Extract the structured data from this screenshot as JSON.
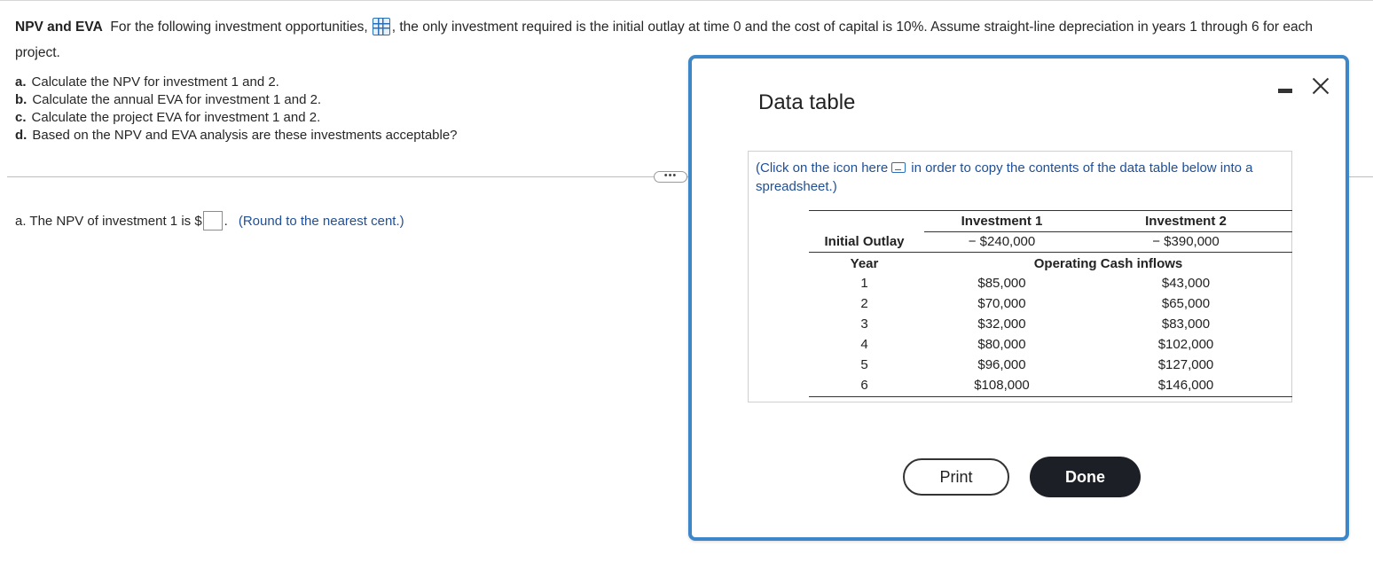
{
  "question": {
    "title": "NPV and EVA",
    "text_before_icon": "For the following investment opportunities,",
    "text_after_icon": ", the only investment required is the initial outlay at time 0 and the cost of capital is 10%. Assume straight-line depreciation in years 1 through 6 for each project.",
    "icon": "data-table-grid-icon"
  },
  "parts": [
    {
      "letter": "a.",
      "text": "Calculate the NPV for investment 1 and 2."
    },
    {
      "letter": "b.",
      "text": "Calculate the annual EVA for investment 1 and 2."
    },
    {
      "letter": "c.",
      "text": "Calculate the project EVA for investment 1 and 2."
    },
    {
      "letter": "d.",
      "text": "Based on the NPV and EVA analysis are these investments acceptable?"
    }
  ],
  "more_button": "•••",
  "answer": {
    "prefix": "a. The NPV of investment 1 is $",
    "value": "",
    "suffix": ".",
    "hint": "(Round to the nearest cent.)"
  },
  "modal": {
    "title": "Data table",
    "copy_note_before": "(Click on the icon here",
    "copy_note_after": "in order to copy the contents of the data table below into a spreadsheet.)",
    "copy_icon": "copy-icon",
    "table": {
      "headers": [
        "",
        "Investment 1",
        "Investment 2"
      ],
      "initial_outlay": {
        "label": "Initial Outlay",
        "inv1": "− $240,000",
        "inv2": "− $390,000"
      },
      "year_label": "Year",
      "section_label": "Operating Cash inflows",
      "rows": [
        {
          "year": "1",
          "inv1": "$85,000",
          "inv2": "$43,000"
        },
        {
          "year": "2",
          "inv1": "$70,000",
          "inv2": "$65,000"
        },
        {
          "year": "3",
          "inv1": "$32,000",
          "inv2": "$83,000"
        },
        {
          "year": "4",
          "inv1": "$80,000",
          "inv2": "$102,000"
        },
        {
          "year": "5",
          "inv1": "$96,000",
          "inv2": "$127,000"
        },
        {
          "year": "6",
          "inv1": "$108,000",
          "inv2": "$146,000"
        }
      ]
    },
    "buttons": {
      "print": "Print",
      "done": "Done"
    }
  },
  "colors": {
    "accent_blue": "#3d87c8",
    "link_blue": "#1f4f96",
    "done_bg": "#1c1f26"
  }
}
